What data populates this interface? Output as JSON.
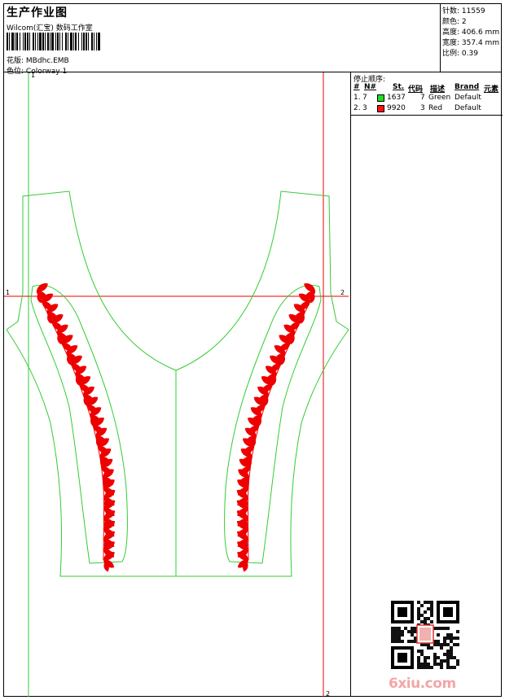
{
  "header": {
    "title": "生产作业图",
    "company": "Wilcom(汇宝) 数码工作室",
    "design_label": "花版:",
    "design_value": "MBdhc.EMB",
    "colorway_label": "色位:",
    "colorway_value": "Colorway 1"
  },
  "stats": [
    {
      "label": "针数:",
      "value": "11559"
    },
    {
      "label": "颜色:",
      "value": "2"
    },
    {
      "label": "高度:",
      "value": "406.6 mm"
    },
    {
      "label": "宽度:",
      "value": "357.4 mm"
    },
    {
      "label": "比例:",
      "value": "0.39"
    }
  ],
  "stop_sequence": {
    "title": "停止顺序:",
    "columns": [
      "#",
      "N#",
      "St.",
      "代码",
      "描述",
      "Brand",
      "元素"
    ],
    "rows": [
      {
        "index": "1.",
        "n": "7",
        "stitches": "1637",
        "code": "7",
        "desc": "Green",
        "brand": "Default",
        "color": "#22dd22"
      },
      {
        "index": "2.",
        "n": "3",
        "stitches": "9920",
        "code": "3",
        "desc": "Red",
        "brand": "Default",
        "color": "#ff1111"
      }
    ]
  },
  "canvas": {
    "guide_labels": {
      "v1": "1",
      "v2": "2",
      "h1": "1",
      "h2": "2"
    },
    "colors": {
      "outline": "#33cc33",
      "motif": "#ee0000",
      "guide": "#ee0000"
    }
  },
  "watermark": {
    "logo_text": "6xiu.com"
  }
}
